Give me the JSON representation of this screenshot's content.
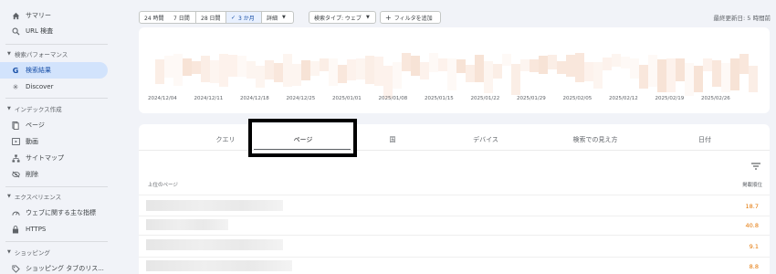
{
  "sidebar": {
    "top_items": [
      {
        "label": "サマリー",
        "icon": "home-icon"
      },
      {
        "label": "URL 検査",
        "icon": "search-icon"
      }
    ],
    "sections": [
      {
        "title": "検索パフォーマンス",
        "items": [
          {
            "label": "検索結果",
            "icon": "google-g-icon",
            "active": true
          },
          {
            "label": "Discover",
            "icon": "asterisk-icon"
          }
        ]
      },
      {
        "title": "インデックス作成",
        "items": [
          {
            "label": "ページ",
            "icon": "pages-icon"
          },
          {
            "label": "動画",
            "icon": "video-icon"
          },
          {
            "label": "サイトマップ",
            "icon": "sitemap-icon"
          },
          {
            "label": "削除",
            "icon": "eye-off-icon"
          }
        ]
      },
      {
        "title": "エクスペリエンス",
        "items": [
          {
            "label": "ウェブに関する主な指標",
            "icon": "gauge-icon"
          },
          {
            "label": "HTTPS",
            "icon": "lock-icon"
          }
        ]
      },
      {
        "title": "ショッピング",
        "items": [
          {
            "label": "ショッピング タブのリス...",
            "icon": "tag-icon"
          }
        ]
      }
    ]
  },
  "filters": {
    "range_24h": "24 時間",
    "range_7d": "7 日間",
    "range_28d": "28 日間",
    "range_3m": "3 か月",
    "range_detail": "詳細",
    "search_type": "検索タイプ: ウェブ",
    "add_filter": "フィルタを追加",
    "last_updated": "最終更新日: 5 時間前"
  },
  "chart": {
    "x_labels": [
      "2024/12/04",
      "2024/12/11",
      "2024/12/18",
      "2024/12/25",
      "2025/01/01",
      "2025/01/08",
      "2025/01/15",
      "2025/01/22",
      "2025/01/29",
      "2025/02/05",
      "2025/02/12",
      "2025/02/19",
      "2025/02/26"
    ]
  },
  "table": {
    "tabs": [
      "クエリ",
      "ページ",
      "国",
      "デバイス",
      "検索での見え方",
      "日付"
    ],
    "active_tab": "ページ",
    "col_left": "上位のページ",
    "col_right": "掲載順位",
    "rows": [
      {
        "value": "18.7"
      },
      {
        "value": "40.8"
      },
      {
        "value": "9.1"
      },
      {
        "value": "8.8"
      }
    ]
  },
  "colors": {
    "accent": "#d2e3fc",
    "position_value": "#e37400",
    "highlight_border": "#000000"
  }
}
